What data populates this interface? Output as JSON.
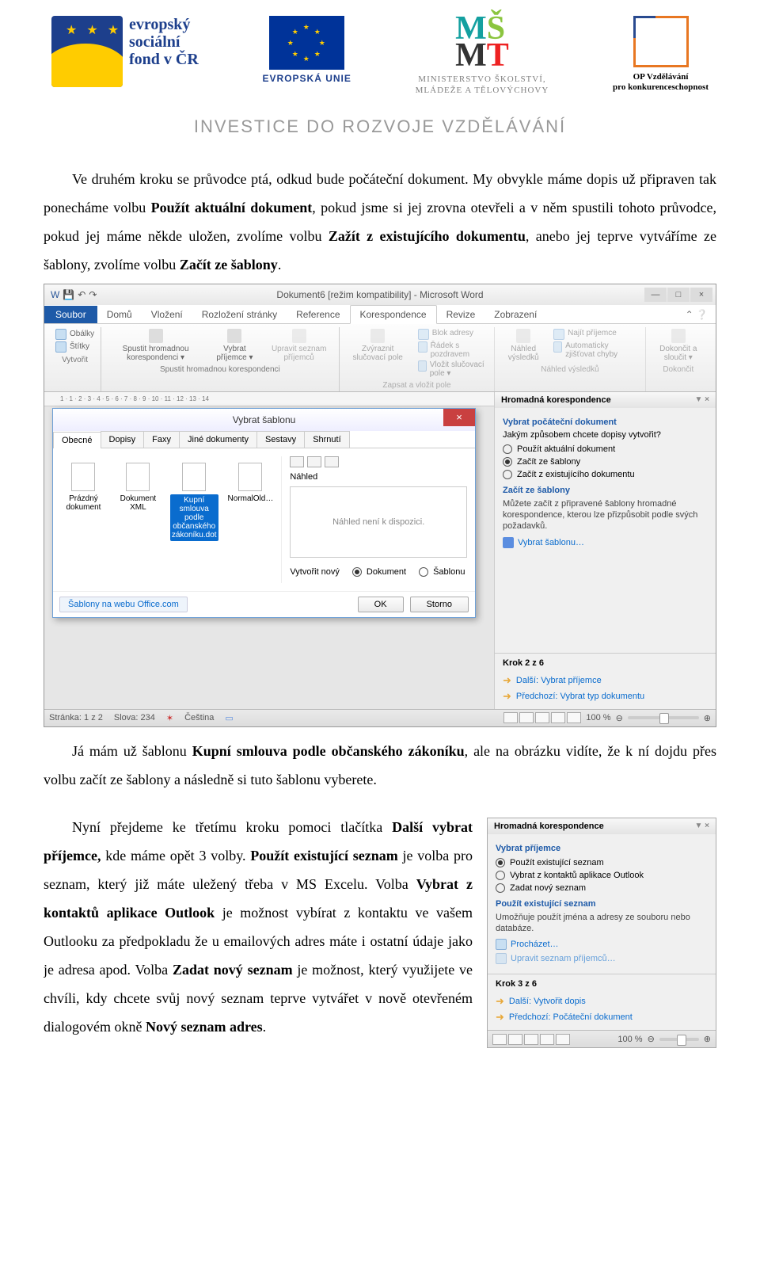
{
  "header": {
    "esf1": "evropský",
    "esf2": "sociální",
    "esf3": "fond v ČR",
    "eu": "EVROPSKÁ UNIE",
    "msmt_top": "MŠMT",
    "msmt_sub1": "MINISTERSTVO ŠKOLSTVÍ,",
    "msmt_sub2": "MLÁDEŽE A TĚLOVÝCHOVY",
    "op1": "OP Vzdělávání",
    "op2": "pro konkurenceschopnost",
    "tagline": "INVESTICE DO ROZVOJE VZDĚLÁVÁNÍ"
  },
  "body": {
    "p1a": "Ve druhém kroku se průvodce ptá, odkud bude počáteční dokument. My obvykle máme dopis už připraven tak ponecháme volbu ",
    "p1b": "Použít aktuální dokument",
    "p1c": ", pokud jsme si jej zrovna otevřeli a v něm spustili tohoto průvodce, pokud jej máme někde uložen, zvolíme volbu ",
    "p1d": "Zažít z existujícího dokumentu",
    "p1e": ", anebo jej teprve vytváříme ze šablony, zvolíme volbu ",
    "p1f": "Začít ze šablony",
    "p1g": ".",
    "p2a": "Já mám už šablonu ",
    "p2b": "Kupní smlouva podle občanského zákoníku",
    "p2c": ", ale na obrázku vidíte, že k ní dojdu přes volbu začít ze šablony a následně si tuto šablonu vyberete.",
    "p3a": "Nyní přejdeme ke třetímu kroku pomoci tlačítka ",
    "p3b": "Další vybrat příjemce,",
    "p3c": " kde máme opět 3 volby. ",
    "p3d": "Použít existující seznam",
    "p3e": " je volba pro seznam, který již máte uležený třeba v MS Excelu. Volba ",
    "p3f": "Vybrat z kontaktů aplikace Outlook",
    "p3g": " je možnost vybírat z kontaktu ve vašem Outlooku za předpokladu že u emailových adres máte i ostatní údaje jako je adresa apod. Volba ",
    "p3h": "Zadat nový seznam",
    "p3i": " je možnost, který využijete ve chvíli, kdy chcete svůj nový seznam teprve vytvářet v nově otevřeném dialogovém okně ",
    "p3j": "Nový seznam adres",
    "p3k": "."
  },
  "word": {
    "title": "Dokument6 [režim kompatibility] - Microsoft Word",
    "tabs": {
      "soubor": "Soubor",
      "domu": "Domů",
      "vlozeni": "Vložení",
      "rozlozeni": "Rozložení stránky",
      "reference": "Reference",
      "korespondence": "Korespondence",
      "revize": "Revize",
      "zobrazeni": "Zobrazení"
    },
    "rib": {
      "obalky": "Obálky",
      "stitky": "Štítky",
      "spustit": "Spustit hromadnou korespondenci ▾",
      "vybrat": "Vybrat příjemce ▾",
      "upravit": "Upravit seznam příjemců",
      "zvyraznit": "Zvýraznit slučovací pole",
      "blok": "Blok adresy",
      "radek": "Řádek s pozdravem",
      "vlozit": "Vložit slučovací pole ▾",
      "nahled": "Náhled výsledků",
      "najit": "Najít příjemce",
      "auto": "Automaticky zjišťovat chyby",
      "dokoncit": "Dokončit a sloučit ▾",
      "g1": "Vytvořit",
      "g2": "Spustit hromadnou korespondenci",
      "g3": "Zapsat a vložit pole",
      "g4": "Náhled výsledků",
      "g5": "Dokončit"
    },
    "ruler": "1 · 1 · 2 · 3 · 4 · 5 · 6 · 7 · 8 · 9 · 10 · 11 · 12 · 13 · 14",
    "dialog": {
      "title": "Vybrat šablonu",
      "tabs": [
        "Obecné",
        "Dopisy",
        "Faxy",
        "Jiné dokumenty",
        "Sestavy",
        "Shrnutí"
      ],
      "items": {
        "prazdny": "Prázdný dokument",
        "xml": "Dokument XML",
        "kupni": "Kupní smlouva podle občanského zákoníku.dot",
        "normal": "NormalOld…"
      },
      "preview": "Náhled",
      "preview_empty": "Náhled není k dispozici.",
      "create": "Vytvořit nový",
      "r1": "Dokument",
      "r2": "Šablonu",
      "link": "Šablony na webu Office.com",
      "ok": "OK",
      "storno": "Storno"
    },
    "pane2": {
      "title": "Hromadná korespondence",
      "h1": "Vybrat počáteční dokument",
      "q": "Jakým způsobem chcete dopisy vytvořit?",
      "r1": "Použít aktuální dokument",
      "r2": "Začít ze šablony",
      "r3": "Začít z existujícího dokumentu",
      "h2": "Začít ze šablony",
      "desc": "Můžete začít z připravené šablony hromadné korespondence, kterou lze přizpůsobit podle svých požadavků.",
      "link": "Vybrat šablonu…",
      "step": "Krok 2 z 6",
      "next": "Další: Vybrat příjemce",
      "prev": "Předchozí: Vybrat typ dokumentu"
    },
    "status": {
      "page": "Stránka: 1 z 2",
      "words": "Slova: 234",
      "lang": "Čeština",
      "zoom": "100 %"
    }
  },
  "pane3": {
    "title": "Hromadná korespondence",
    "h1": "Vybrat příjemce",
    "r1": "Použít existující seznam",
    "r2": "Vybrat z kontaktů aplikace Outlook",
    "r3": "Zadat nový seznam",
    "h2": "Použít existující seznam",
    "desc": "Umožňuje použít jména a adresy ze souboru nebo databáze.",
    "link1": "Procházet…",
    "link2": "Upravit seznam příjemců…",
    "step": "Krok 3 z 6",
    "next": "Další: Vytvořit dopis",
    "prev": "Předchozí: Počáteční dokument",
    "zoom": "100 %"
  }
}
